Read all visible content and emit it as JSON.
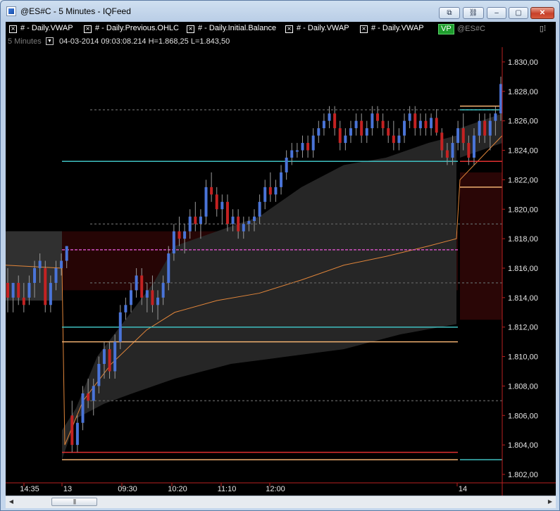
{
  "window": {
    "title": "@ES#C - 5 Minutes - IQFeed",
    "buttons": {
      "restore_alt": "⧉",
      "link": "⛓",
      "minimize": "–",
      "maximize": "▢",
      "close": "✕"
    }
  },
  "toolbar": {
    "indicators": [
      {
        "label": "# - Daily.VWAP"
      },
      {
        "label": "# - Daily.Previous.OHLC"
      },
      {
        "label": "# - Daily.Initial.Balance"
      },
      {
        "label": "# - Daily.VWAP"
      },
      {
        "label": "# - Daily.VWAP"
      }
    ],
    "close_glyph": "×",
    "vp_badge": "VP",
    "vp_symbol": "@ES#C",
    "pin_glyph": "▯⁞"
  },
  "info_row": {
    "timeframe": "5 Minutes",
    "dropdown_glyph": "▼",
    "bar_info": "04-03-2014  09:03:08.214  H=1.868,25  L=1.843,50"
  },
  "scroll": {
    "left_arrow": "◀",
    "right_arrow": "▶",
    "grip": "|||"
  },
  "colors": {
    "up": "#4a74d8",
    "down": "#c42222",
    "band": "#262626",
    "vwap": "#e0853a",
    "cyan": "#3fbfc0",
    "red_line": "#e03030",
    "orange_line": "#f0b070",
    "magenta": "#d050c0",
    "axis": "#b82020"
  },
  "chart_data": {
    "type": "candlestick",
    "x_ticks": [
      "14:35",
      "13",
      "09:30",
      "10:20",
      "11:10",
      "12:00",
      "14"
    ],
    "y_ticks": [
      "1.802,00",
      "1.804,00",
      "1.806,00",
      "1.808,00",
      "1.810,00",
      "1.812,00",
      "1.814,00",
      "1.816,00",
      "1.818,00",
      "1.820,00",
      "1.822,00",
      "1.824,00",
      "1.826,00",
      "1.828,00",
      "1.830,00"
    ],
    "ylim": [
      1801.5,
      1831
    ],
    "levels": {
      "cyan_1": 1823.25,
      "cyan_2": 1812.0,
      "cyan_3": 1826.75,
      "cyan_4": 1803.0,
      "red_1": 1803.5,
      "red_2": 1823.25,
      "orange_1": 1811.0,
      "orange_2": 1803.0,
      "orange_3": 1821.5,
      "orange_4": 1827.0,
      "magenta": 1817.25,
      "dashed_gray": [
        1826.75,
        1819.0,
        1815.0,
        1807.0
      ]
    },
    "candles": [
      [
        1815,
        1816,
        1813,
        1814
      ],
      [
        1814,
        1815,
        1813,
        1815
      ],
      [
        1815,
        1815.5,
        1813.5,
        1814
      ],
      [
        1814,
        1815,
        1813,
        1813.5
      ],
      [
        1814,
        1815.5,
        1813.5,
        1815
      ],
      [
        1815,
        1816.5,
        1814,
        1816
      ],
      [
        1816,
        1817,
        1815,
        1816.5
      ],
      [
        1816,
        1816.5,
        1813,
        1813.5
      ],
      [
        1813.5,
        1815.5,
        1813,
        1815
      ],
      [
        1815,
        1816.5,
        1814.5,
        1816
      ],
      [
        1816,
        1817,
        1815.5,
        1816.5
      ],
      [
        1816.5,
        1817.5,
        1816,
        1817.5
      ],
      [
        1806,
        1807,
        1803.5,
        1804
      ],
      [
        1804,
        1806,
        1803.5,
        1805.5
      ],
      [
        1805.5,
        1808,
        1805,
        1807.5
      ],
      [
        1807.5,
        1808.5,
        1806.5,
        1807
      ],
      [
        1807,
        1808.5,
        1806,
        1808
      ],
      [
        1808,
        1810,
        1807.5,
        1809.5
      ],
      [
        1809.5,
        1811,
        1808.5,
        1810.5
      ],
      [
        1810.5,
        1811,
        1808.5,
        1809
      ],
      [
        1809,
        1811.5,
        1808.5,
        1811
      ],
      [
        1811,
        1813.5,
        1810.5,
        1813
      ],
      [
        1813,
        1814,
        1812.5,
        1813.5
      ],
      [
        1813.5,
        1815,
        1813,
        1814.5
      ],
      [
        1814.5,
        1816,
        1814,
        1815.5
      ],
      [
        1815.5,
        1816,
        1813.5,
        1814
      ],
      [
        1814,
        1815,
        1813,
        1814.5
      ],
      [
        1814.5,
        1815.5,
        1813,
        1813.5
      ],
      [
        1813.5,
        1814.5,
        1812.5,
        1814
      ],
      [
        1814,
        1815.5,
        1813.5,
        1815
      ],
      [
        1815,
        1817.5,
        1814.5,
        1817
      ],
      [
        1817,
        1819,
        1816.5,
        1818.5
      ],
      [
        1818.5,
        1819.5,
        1817.5,
        1818
      ],
      [
        1818,
        1819,
        1817,
        1818.5
      ],
      [
        1818.5,
        1820,
        1818,
        1819.5
      ],
      [
        1819.5,
        1820.5,
        1818.5,
        1819
      ],
      [
        1819,
        1820,
        1818,
        1819.5
      ],
      [
        1819.5,
        1822,
        1819,
        1821.5
      ],
      [
        1821.5,
        1822.5,
        1820.5,
        1821
      ],
      [
        1821,
        1821.5,
        1819.5,
        1820
      ],
      [
        1820,
        1821,
        1819,
        1820.5
      ],
      [
        1820.5,
        1821,
        1818.5,
        1819
      ],
      [
        1819,
        1820,
        1818.5,
        1819.5
      ],
      [
        1819.5,
        1820,
        1818,
        1818.5
      ],
      [
        1818.5,
        1819.5,
        1818,
        1819
      ],
      [
        1819,
        1819.5,
        1818.5,
        1819.2
      ],
      [
        1819.2,
        1820,
        1818.5,
        1819.5
      ],
      [
        1819.5,
        1821,
        1819,
        1820.5
      ],
      [
        1820.5,
        1822,
        1820,
        1821.5
      ],
      [
        1821.5,
        1822.5,
        1820.5,
        1821
      ],
      [
        1821,
        1822,
        1820.5,
        1821.5
      ],
      [
        1821.5,
        1823,
        1821,
        1822.5
      ],
      [
        1822.5,
        1824,
        1822,
        1823.5
      ],
      [
        1823.5,
        1824.5,
        1823,
        1824
      ],
      [
        1824,
        1824.5,
        1823.5,
        1824
      ],
      [
        1824,
        1825,
        1823.5,
        1824.5
      ],
      [
        1824.5,
        1825,
        1823.5,
        1824
      ],
      [
        1824,
        1825.5,
        1823.5,
        1825
      ],
      [
        1825,
        1826,
        1824.5,
        1825.5
      ],
      [
        1825.5,
        1826.5,
        1825,
        1826
      ],
      [
        1826,
        1827,
        1825.5,
        1826.5
      ],
      [
        1826.5,
        1827,
        1825,
        1825.5
      ],
      [
        1825.5,
        1826,
        1824,
        1824.5
      ],
      [
        1824.5,
        1825.5,
        1824,
        1825
      ],
      [
        1825,
        1826,
        1824.5,
        1825.5
      ],
      [
        1825.5,
        1826.5,
        1825,
        1826
      ],
      [
        1826,
        1826.5,
        1824.5,
        1825
      ],
      [
        1825,
        1826,
        1824.5,
        1825.5
      ],
      [
        1825.5,
        1827,
        1825,
        1826.5
      ],
      [
        1826.5,
        1827,
        1825.5,
        1826
      ],
      [
        1826,
        1826.5,
        1825,
        1825.5
      ],
      [
        1825.5,
        1826,
        1824.5,
        1825
      ],
      [
        1825,
        1826,
        1824,
        1824.5
      ],
      [
        1824.5,
        1825.5,
        1824,
        1825
      ],
      [
        1825,
        1826.5,
        1824.5,
        1826
      ],
      [
        1826,
        1827,
        1825.5,
        1826.5
      ],
      [
        1826.5,
        1827,
        1825,
        1825.5
      ],
      [
        1825.5,
        1826.5,
        1825,
        1826
      ],
      [
        1826,
        1826.5,
        1825,
        1825.5
      ],
      [
        1825.5,
        1826.5,
        1825,
        1826.2
      ],
      [
        1826.2,
        1826.8,
        1825,
        1825.2
      ],
      [
        1825.2,
        1825.5,
        1823.5,
        1824
      ],
      [
        1824,
        1824.5,
        1823,
        1823.5
      ],
      [
        1823.5,
        1825,
        1823,
        1824.5
      ],
      [
        1824.5,
        1826,
        1824,
        1825.5
      ],
      [
        1825.5,
        1826.5,
        1824,
        1824.5
      ],
      [
        1824.5,
        1825,
        1823,
        1823.5
      ],
      [
        1823.5,
        1825.5,
        1823,
        1825
      ],
      [
        1825,
        1826.5,
        1824.5,
        1826
      ],
      [
        1826,
        1826.5,
        1824.5,
        1825
      ],
      [
        1825,
        1826.5,
        1824,
        1826
      ],
      [
        1826,
        1827,
        1825,
        1826.5
      ],
      [
        1826.5,
        1829,
        1826,
        1828.5
      ]
    ]
  }
}
